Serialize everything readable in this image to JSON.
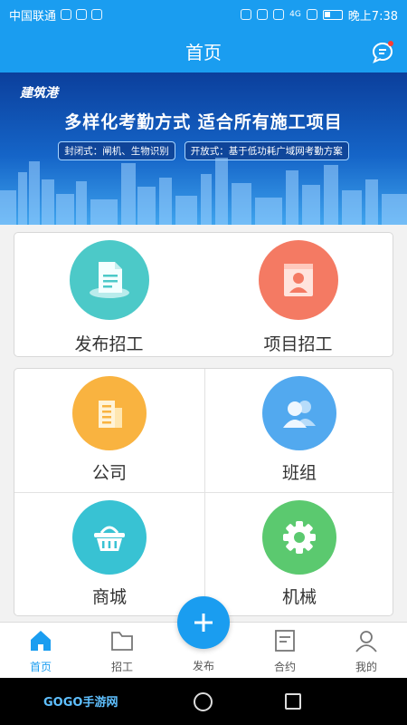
{
  "status_bar": {
    "carrier": "中国联通",
    "time": "晚上7:38",
    "network": "4G"
  },
  "header": {
    "title": "首页"
  },
  "banner": {
    "logo": "建筑港",
    "headline": "多样化考勤方式 适合所有施工项目",
    "tag_closed": "封闭式：闸机、生物识别",
    "tag_open": "开放式：基于低功耗广域网考勤方案"
  },
  "quick_actions": [
    {
      "label": "发布招工",
      "icon": "document-icon",
      "color": "#4cc9c8"
    },
    {
      "label": "项目招工",
      "icon": "id-card-icon",
      "color": "#f47a63"
    }
  ],
  "grid": [
    {
      "label": "公司",
      "icon": "building-icon",
      "color": "#f9b340"
    },
    {
      "label": "班组",
      "icon": "group-icon",
      "color": "#52a9ef"
    },
    {
      "label": "商城",
      "icon": "basket-icon",
      "color": "#38c2d3"
    },
    {
      "label": "机械",
      "icon": "gear-icon",
      "color": "#5bc96f"
    }
  ],
  "tabs": [
    {
      "label": "首页",
      "icon": "home-icon",
      "active": true
    },
    {
      "label": "招工",
      "icon": "folder-icon",
      "active": false
    },
    {
      "label": "发布",
      "icon": "plus-icon",
      "active": false
    },
    {
      "label": "合约",
      "icon": "contract-icon",
      "active": false
    },
    {
      "label": "我的",
      "icon": "user-icon",
      "active": false
    }
  ],
  "watermark": "GOGO手游网",
  "colors": {
    "primary": "#1a9df0"
  }
}
